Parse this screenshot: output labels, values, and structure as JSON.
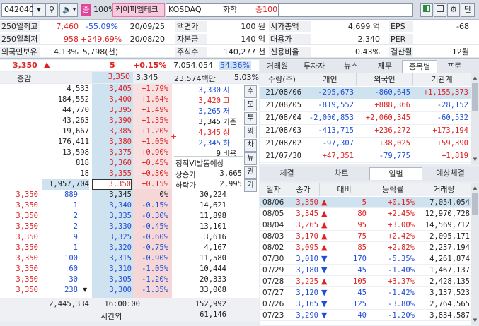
{
  "toolbar": {
    "code": "042040",
    "zoom": "100%",
    "stock_name": "케이피엠테크",
    "market": "KOSDAQ",
    "sector": "화학",
    "margin": "증100",
    "badge": "증"
  },
  "info": {
    "rows": [
      [
        {
          "l": "250일최고",
          "v": "7,460"
        },
        {
          "v": "-55.09%"
        },
        {
          "v": "20/09/25"
        },
        {
          "l": "액면가",
          "v": "100 원"
        },
        {
          "l": "시가총액",
          "v": "4,699 억"
        },
        {
          "l": "EPS",
          "v": "-68"
        }
      ],
      [
        {
          "l": "250일최저",
          "v": "958"
        },
        {
          "v": "+249.69%"
        },
        {
          "v": "20/08/20"
        },
        {
          "l": "자본금",
          "v": "140 억"
        },
        {
          "l": "대용가",
          "v": "2,340"
        },
        {
          "l": "PER",
          "v": ""
        }
      ],
      [
        {
          "l": "외국인보유",
          "v": "4.13%"
        },
        {
          "v": "5,798(천)"
        },
        {
          "v": ""
        },
        {
          "l": "주식수",
          "v": "140,277 천"
        },
        {
          "l": "신용비율",
          "v": "0.43%"
        },
        {
          "l": "결산월",
          "v": "12월"
        }
      ]
    ]
  },
  "price": {
    "current": "3,350",
    "change": "5",
    "rate": "+0.15%",
    "volume": "7,054,054",
    "vol_rate": "54.36%",
    "diff_label": "증감",
    "ask_total": "3,350",
    "bid_total": "3,345",
    "amount": "23,574백만",
    "turnover": "5.03%"
  },
  "book": {
    "asks": [
      {
        "qty": "4,533",
        "price": "3,405",
        "rate": "+1.79%"
      },
      {
        "qty": "184,552",
        "price": "3,400",
        "rate": "+1.64%"
      },
      {
        "qty": "44,770",
        "price": "3,395",
        "rate": "+1.49%"
      },
      {
        "qty": "43,263",
        "price": "3,390",
        "rate": "+1.35%"
      },
      {
        "qty": "19,667",
        "price": "3,385",
        "rate": "+1.20%"
      },
      {
        "qty": "176,411",
        "price": "3,380",
        "rate": "+1.05%"
      },
      {
        "qty": "13,598",
        "price": "3,375",
        "rate": "+0.90%"
      },
      {
        "qty": "818",
        "price": "3,360",
        "rate": "+0.45%"
      },
      {
        "qty": "18",
        "price": "3,355",
        "rate": "+0.30%"
      },
      {
        "qty": "1,957,704",
        "price": "3,350",
        "rate": "+0.15%"
      }
    ],
    "bids": [
      {
        "tick": "3,350",
        "tq": "889",
        "price": "3,345",
        "rate": "0%",
        "qty": "30,224"
      },
      {
        "tick": "3,350",
        "tq": "1",
        "price": "3,340",
        "rate": "-0.15%",
        "qty": "14,621"
      },
      {
        "tick": "3,350",
        "tq": "2",
        "price": "3,335",
        "rate": "-0.30%",
        "qty": "11,898"
      },
      {
        "tick": "3,350",
        "tq": "2",
        "price": "3,330",
        "rate": "-0.45%",
        "qty": "13,101"
      },
      {
        "tick": "3,350",
        "tq": "9",
        "price": "3,325",
        "rate": "-0.60%",
        "qty": "3,616"
      },
      {
        "tick": "3,350",
        "tq": "1",
        "price": "3,320",
        "rate": "-0.75%",
        "qty": "4,167"
      },
      {
        "tick": "3,350",
        "tq": "100",
        "price": "3,315",
        "rate": "-0.90%",
        "qty": "11,580"
      },
      {
        "tick": "3,350",
        "tq": "60",
        "price": "3,310",
        "rate": "-1.05%",
        "qty": "10,444"
      },
      {
        "tick": "3,350",
        "tq": "30",
        "price": "3,305",
        "rate": "-1.20%",
        "qty": "20,333"
      },
      {
        "tick": "3,350",
        "tq": "238",
        "price": "3,300",
        "rate": "-1.35%",
        "qty": "33,008"
      }
    ],
    "ohlc": [
      {
        "v": "3,330",
        "l": "시"
      },
      {
        "v": "3,420",
        "l": "고"
      },
      {
        "v": "3,265",
        "l": "저"
      },
      {
        "v": "3,345",
        "l": "기준"
      },
      {
        "v": "4,345",
        "l": "상"
      },
      {
        "v": "2,345",
        "l": "하"
      },
      {
        "v": "9",
        "l": "비용"
      }
    ],
    "vi_title": "정적VI발동예상",
    "vi_up_label": "상승가",
    "vi_up": "3,665",
    "vi_down_label": "하락가",
    "vi_down": "2,995",
    "side_buttons": [
      "수",
      "도",
      "투",
      "외",
      "차",
      "뉴",
      "권",
      "기"
    ],
    "total_ask": "2,445,334",
    "time": "16:00:00",
    "time_label": "시간외",
    "total_bid": "152,992",
    "after_qty": "61,146"
  },
  "investor": {
    "tabs": [
      "거래원",
      "투자자",
      "뉴스",
      "재무",
      "종목별",
      "프로"
    ],
    "active": 4,
    "headers": [
      "수량(주)",
      "개인",
      "외국인",
      "기관계"
    ],
    "rows": [
      [
        "21/08/06",
        "-295,673",
        "-860,645",
        "+1,155,373"
      ],
      [
        "21/08/05",
        "-819,552",
        "+888,366",
        "-28,152"
      ],
      [
        "21/08/04",
        "-2,000,853",
        "+2,060,345",
        "-60,532"
      ],
      [
        "21/08/03",
        "-413,715",
        "+236,272",
        "+173,194"
      ],
      [
        "21/08/02",
        "-97,307",
        "+38,025",
        "+59,390"
      ],
      [
        "21/07/30",
        "+47,351",
        "-79,775",
        "+1,819"
      ]
    ]
  },
  "daily": {
    "tabs": [
      "체결",
      "차트",
      "일별",
      "예상체결"
    ],
    "active": 2,
    "headers": [
      "일자",
      "종가",
      "대비",
      "등락률",
      "거래량"
    ],
    "rows": [
      [
        "08/06",
        "3,350",
        "▲",
        "5",
        "+0.15%",
        "7,054,054"
      ],
      [
        "08/05",
        "3,345",
        "▲",
        "80",
        "+2.45%",
        "12,970,728"
      ],
      [
        "08/04",
        "3,265",
        "▲",
        "95",
        "+3.00%",
        "14,569,712"
      ],
      [
        "08/03",
        "3,170",
        "▲",
        "75",
        "+2.42%",
        "2,095,171"
      ],
      [
        "08/02",
        "3,095",
        "▲",
        "85",
        "+2.82%",
        "2,237,194"
      ],
      [
        "07/30",
        "3,010",
        "▼",
        "170",
        "-5.35%",
        "4,261,874"
      ],
      [
        "07/29",
        "3,180",
        "▼",
        "45",
        "-1.40%",
        "1,467,137"
      ],
      [
        "07/28",
        "3,225",
        "▲",
        "105",
        "+3.37%",
        "2,428,135"
      ],
      [
        "07/27",
        "3,120",
        "▼",
        "45",
        "-1.42%",
        "3,137,523"
      ],
      [
        "07/26",
        "3,165",
        "▼",
        "125",
        "-3.80%",
        "2,764,565"
      ],
      [
        "07/23",
        "3,290",
        "▼",
        "40",
        "-1.20%",
        "3,834,587"
      ]
    ]
  },
  "colors": {
    "up": "#e02020",
    "down": "#1f4fd6",
    "accent": "#e0459a"
  }
}
